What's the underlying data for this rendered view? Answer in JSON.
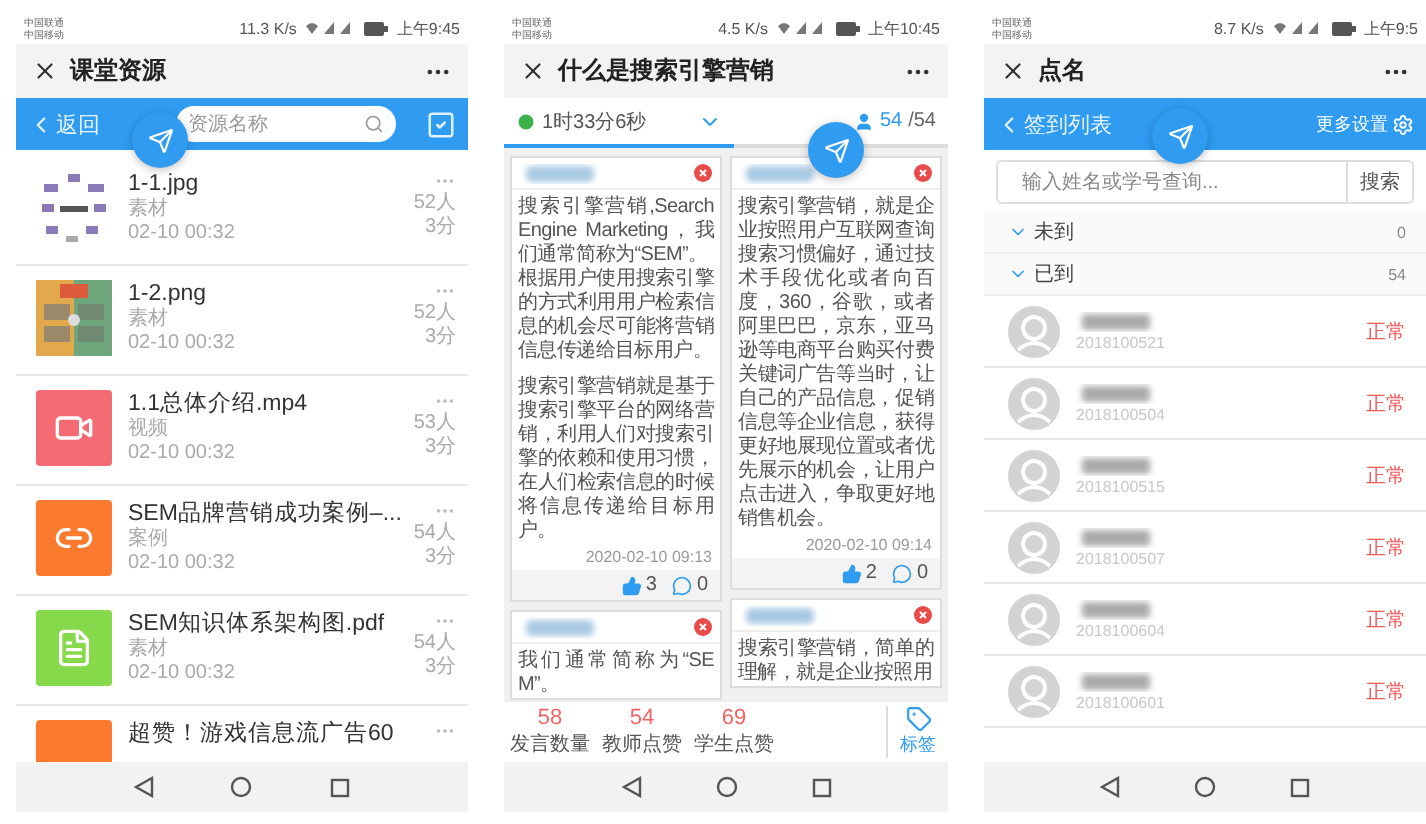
{
  "resources_screen": {
    "status_bar": {
      "carriers": [
        "中国联通",
        "中国移动"
      ],
      "speed": "11.3 K/s",
      "time": "上午9:45"
    },
    "title": "课堂资源",
    "back": "返回",
    "search": {
      "placeholder": "资源名称"
    },
    "items": [
      {
        "title": "1-1.jpg",
        "type": "素材",
        "date": "02-10 00:32",
        "views": "52人",
        "duration": "3分",
        "kind": "diagram"
      },
      {
        "title": "1-2.png",
        "type": "素材",
        "date": "02-10 00:32",
        "views": "52人",
        "duration": "3分",
        "kind": "chart"
      },
      {
        "title": "1.1总体介绍.mp4",
        "type": "视频",
        "date": "02-10 00:32",
        "views": "53人",
        "duration": "3分",
        "kind": "video",
        "color": "#f56b73"
      },
      {
        "title": "SEM品牌营销成功案例–...",
        "type": "案例",
        "date": "02-10 00:32",
        "views": "54人",
        "duration": "3分",
        "kind": "link",
        "color": "#fb7a2e"
      },
      {
        "title": "SEM知识体系架构图.pdf",
        "type": "素材",
        "date": "02-10 00:32",
        "views": "54人",
        "duration": "3分",
        "kind": "document",
        "color": "#86d94a"
      },
      {
        "title": "超赞！游戏信息流广告60",
        "kind": "blank",
        "color": "#fb7a2e"
      }
    ]
  },
  "discussion_screen": {
    "status_bar": {
      "carriers": [
        "中国联通",
        "中国移动"
      ],
      "speed": "4.5 K/s",
      "time": "上午10:45"
    },
    "title": "什么是搜索引擎营销",
    "tabs": [
      {
        "kind": "timer",
        "label": "1时33分6秒",
        "selected": true
      },
      {
        "kind": "count",
        "count": "54",
        "total": "/54",
        "selected": false
      }
    ],
    "columns": [
      [
        {
          "paragraphs": [
            "搜索引擎营销,Search Engine Marketing，我们通常简称为“SEM”。",
            "根据用户使用搜索引擎的方式利用用户检索信息的机会尽可能将营销信息传递给目标用户。",
            "搜索引擎营销就是基于搜索引擎平台的网络营销，利用人们对搜索引擎的依赖和使用习惯，在人们检索信息的时候将信息传递给目标用户。"
          ],
          "time": "2020-02-10 09:13",
          "likes": "3",
          "comments": "0"
        },
        {
          "paragraphs": [
            "我们通常简称为“SEM”。"
          ]
        }
      ],
      [
        {
          "paragraphs": [
            "搜索引擎营销，就是企业按照用户互联网查询搜索习惯偏好，通过技术手段优化或者向百度，360，谷歌，或者阿里巴巴，京东，亚马逊等电商平台购买付费关键词广告等当时，让自己的产品信息，促销信息等企业信息，获得更好地展现位置或者优先展示的机会，让用户点击进入，争取更好地销售机会。"
          ],
          "time": "2020-02-10 09:14",
          "likes": "2",
          "comments": "0"
        },
        {
          "paragraphs": [
            "搜索引擎营销，简单的理解，就是企业按照用"
          ]
        }
      ]
    ],
    "stats": [
      {
        "value": "58",
        "label": "发言数量"
      },
      {
        "value": "54",
        "label": "教师点赞"
      },
      {
        "value": "69",
        "label": "学生点赞"
      }
    ],
    "tag_button": "标签"
  },
  "attendance_screen": {
    "status_bar": {
      "carriers": [
        "中国联通",
        "中国移动"
      ],
      "speed": "8.7 K/s",
      "time": "上午9:5"
    },
    "title": "点名",
    "back": "签到列表",
    "settings": "更多设置",
    "search": {
      "placeholder": "输入姓名或学号查询...",
      "button": "搜索"
    },
    "sections": [
      {
        "label": "未到",
        "count": "0",
        "expanded": true
      },
      {
        "label": "已到",
        "count": "54",
        "expanded": true
      }
    ],
    "students": [
      {
        "student_id": "2018100521",
        "status": "正常"
      },
      {
        "student_id": "2018100504",
        "status": "正常"
      },
      {
        "student_id": "2018100515",
        "status": "正常"
      },
      {
        "student_id": "2018100507",
        "status": "正常"
      },
      {
        "student_id": "2018100604",
        "status": "正常"
      },
      {
        "student_id": "2018100601",
        "status": "正常"
      }
    ]
  }
}
